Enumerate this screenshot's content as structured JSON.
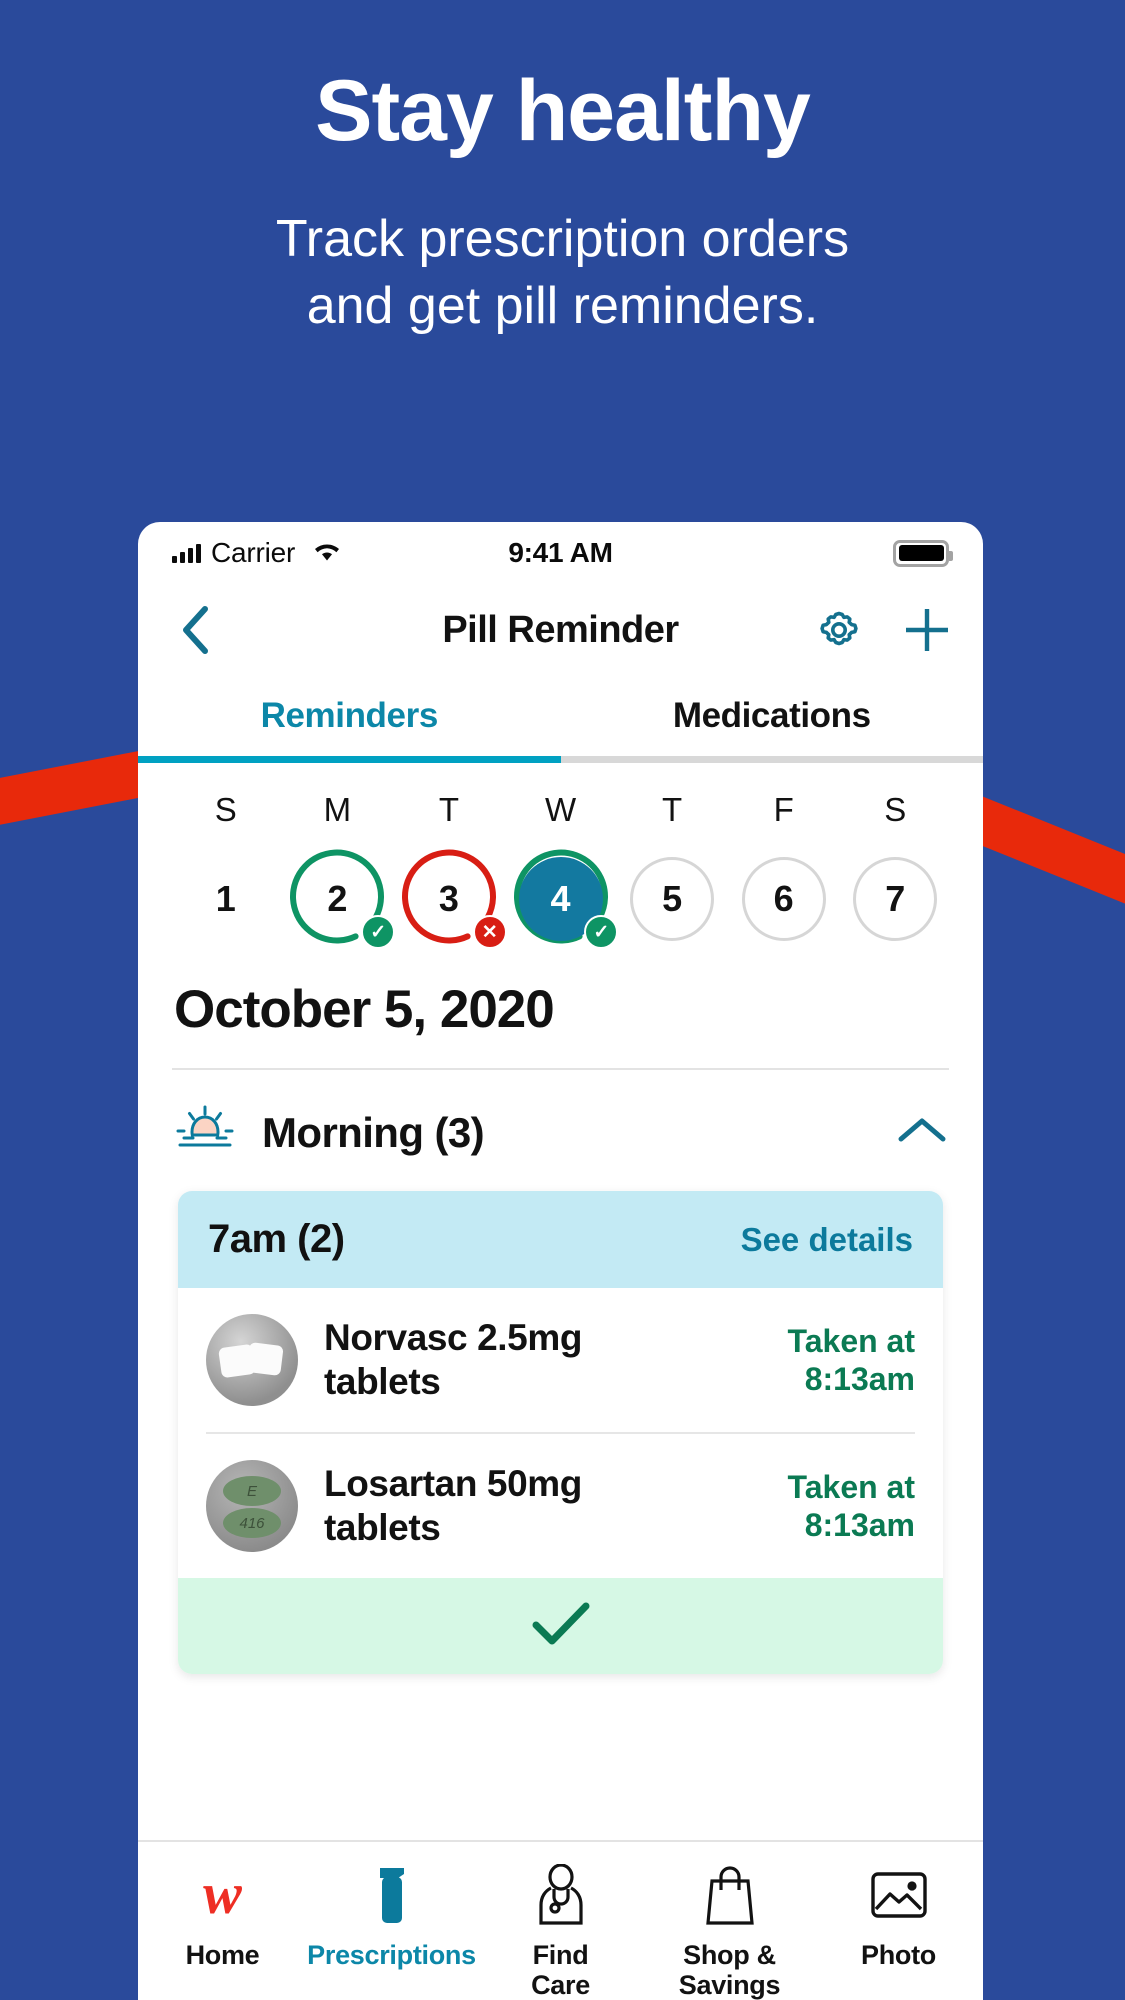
{
  "promo": {
    "headline": "Stay healthy",
    "subhead": "Track prescription orders\nand get pill reminders.",
    "bg_color": "#2a4a9b",
    "stripe_color": "#e8290b"
  },
  "statusbar": {
    "carrier": "Carrier",
    "time": "9:41 AM",
    "signal_icon": "signal-bars-icon",
    "wifi_icon": "wifi-icon",
    "battery_icon": "battery-full-icon"
  },
  "navbar": {
    "back_icon": "chevron-left-icon",
    "title": "Pill Reminder",
    "settings_icon": "gear-icon",
    "add_icon": "plus-icon",
    "accent": "#14708e"
  },
  "tabs": [
    {
      "label": "Reminders",
      "active": true
    },
    {
      "label": "Medications",
      "active": false
    }
  ],
  "calendar": {
    "dow": [
      "S",
      "M",
      "T",
      "W",
      "T",
      "F",
      "S"
    ],
    "days": [
      {
        "num": "1",
        "state": "plain",
        "badge": ""
      },
      {
        "num": "2",
        "state": "taken",
        "badge": "check"
      },
      {
        "num": "3",
        "state": "missed",
        "badge": "x"
      },
      {
        "num": "4",
        "state": "today",
        "badge": "check"
      },
      {
        "num": "5",
        "state": "upcoming",
        "badge": ""
      },
      {
        "num": "6",
        "state": "upcoming",
        "badge": ""
      },
      {
        "num": "7",
        "state": "upcoming",
        "badge": ""
      }
    ],
    "colors": {
      "taken": "#0e9464",
      "missed": "#d81e14",
      "today": "#1379a0",
      "upcoming": "#d6d6d6"
    }
  },
  "date_header": "October 5, 2020",
  "section": {
    "icon": "sunrise-icon",
    "title": "Morning (3)",
    "collapse_icon": "chevron-up-icon"
  },
  "card": {
    "time_label": "7am (2)",
    "details_link": "See details",
    "confirm_icon": "check-icon",
    "rows": [
      {
        "image": "white-round-tablets-photo",
        "name": "Norvasc 2.5mg\ntablets",
        "status": "Taken at\n8:13am"
      },
      {
        "image": "green-oval-tablets-photo",
        "name": "Losartan 50mg\ntablets",
        "status": "Taken at\n8:13am"
      }
    ]
  },
  "bottom_nav": [
    {
      "label": "Home",
      "icon": "walgreens-w-logo-icon",
      "active": false
    },
    {
      "label": "Prescriptions",
      "icon": "pill-bottle-icon",
      "active": true
    },
    {
      "label": "Find\nCare",
      "icon": "doctor-icon",
      "active": false
    },
    {
      "label": "Shop &\nSavings",
      "icon": "shopping-bag-icon",
      "active": false
    },
    {
      "label": "Photo",
      "icon": "photo-icon",
      "active": false
    }
  ]
}
